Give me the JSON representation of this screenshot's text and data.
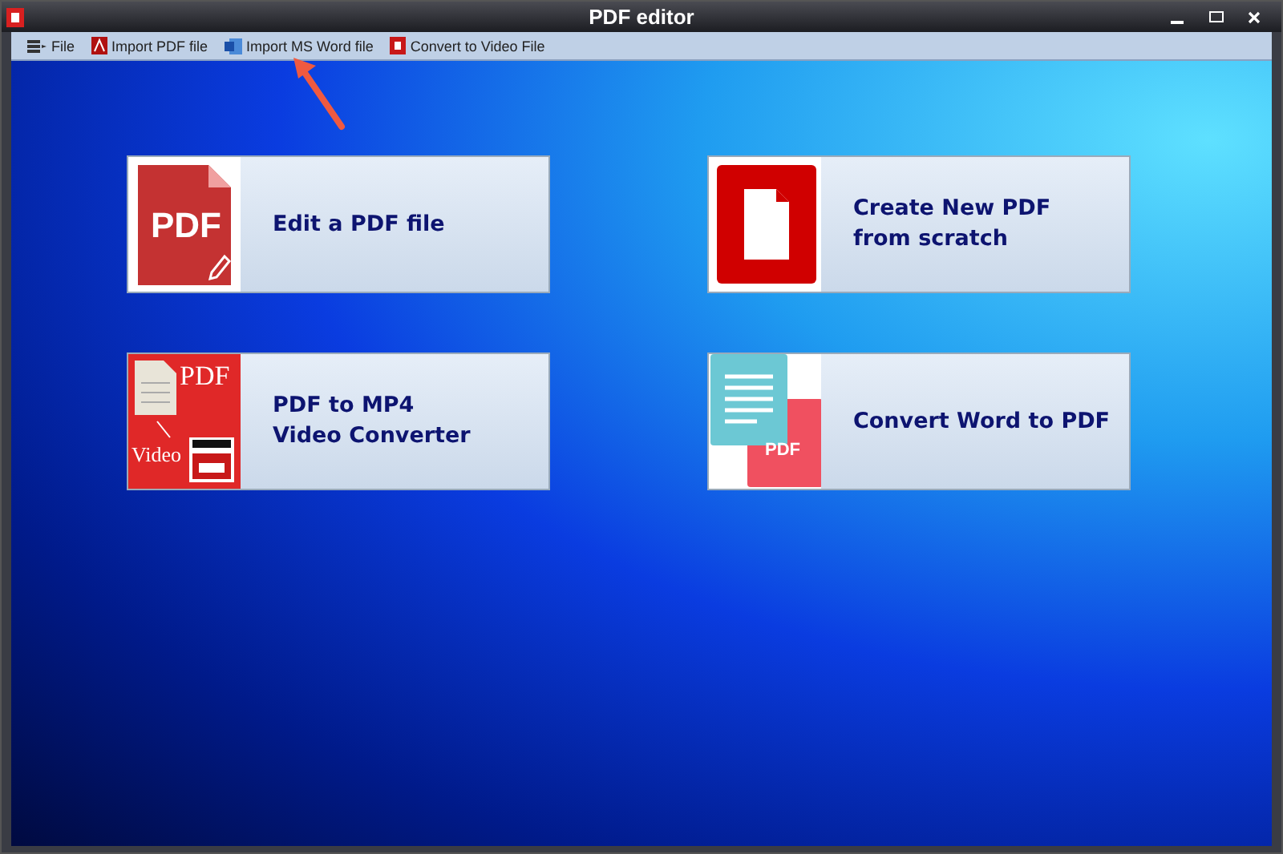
{
  "window": {
    "title": "PDF editor"
  },
  "toolbar": [
    {
      "kind": "file",
      "label": "File"
    },
    {
      "kind": "pdf",
      "label": "Import PDF file"
    },
    {
      "kind": "word",
      "label": "Import MS Word file"
    },
    {
      "kind": "video",
      "label": "Convert to Video File"
    }
  ],
  "tiles": [
    {
      "kind": "edit",
      "label": "Edit a PDF file",
      "icon_texts": [
        "PDF"
      ]
    },
    {
      "kind": "create",
      "label": "Create New PDF\nfrom scratch"
    },
    {
      "kind": "video",
      "label": "PDF to MP4\nVideo Converter",
      "icon_texts": [
        "PDF",
        "Video"
      ]
    },
    {
      "kind": "word",
      "label": "Convert Word to PDF",
      "icon_texts": [
        "PDF"
      ]
    }
  ]
}
